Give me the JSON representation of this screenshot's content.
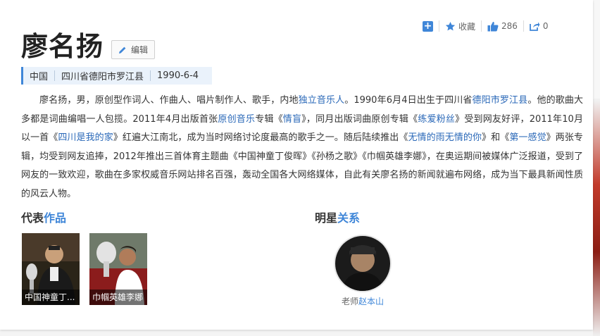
{
  "actions": {
    "favorite_label": "收藏",
    "like_count": "286",
    "share_count": "0"
  },
  "person": {
    "name": "廖名扬",
    "edit_label": "编辑",
    "meta": [
      "中国",
      "四川省德阳市罗江县",
      "1990-6-4"
    ]
  },
  "description": {
    "t1": "廖名扬，男，原创型作词人、作曲人、唱片制作人、歌手，内地",
    "l1": "独立音乐人",
    "t2": "。1990年6月4日出生于四川省",
    "l2": "德阳市罗江县",
    "t3": "。他的歌曲大多都是词曲编唱一人包揽。2011年4月出版首张",
    "l3": "原创音乐",
    "t4": "专辑《",
    "l4": "情盲",
    "t5": "》，同月出版词曲原创专辑《",
    "l5": "练爱粉丝",
    "t6": "》受到网友好评，2011年10月以一首《",
    "l6": "四川是我的家",
    "t7": "》红遍大江南北，成为当时网络讨论度最高的歌手之一。随后陆续推出《",
    "l7": "无情的雨无情的你",
    "t8": "》和《",
    "l8": "第一感觉",
    "t9": "》两张专辑，均受到网友追捧，2012年推出三首体育主题曲《中国神童丁俊晖》《孙杨之歌》《巾帼英雄李娜》，在奥运期间被媒体广泛报道，受到了网友的一致欢迎，歌曲在多家权威音乐网站排名百强，轰动全国各大网络媒体，自此有关廖名扬的新闻就遍布网络，成为当下最具新闻性质的风云人物。"
  },
  "works": {
    "title_a": "代表",
    "title_b": "作品",
    "items": [
      {
        "caption": "中国神童丁..."
      },
      {
        "caption": "巾帼英雄李娜"
      }
    ]
  },
  "relations": {
    "title_a": "明星",
    "title_b": "关系",
    "star": {
      "role": "老师",
      "name": "赵本山"
    }
  },
  "colors": {
    "accent": "#3f86d8",
    "link": "#2a68b8",
    "meta_bg": "#eaf2fb"
  }
}
